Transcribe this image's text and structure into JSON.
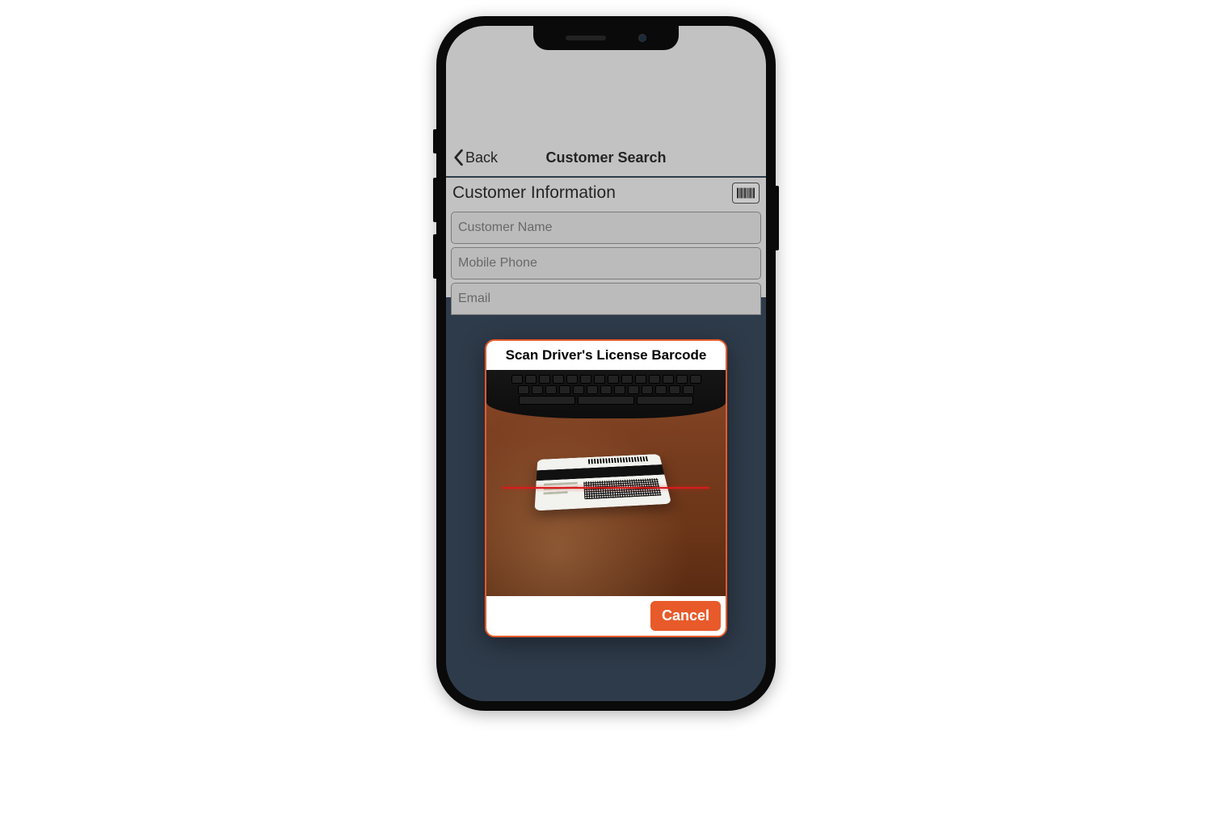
{
  "nav": {
    "back_label": "Back",
    "title": "Customer Search"
  },
  "section": {
    "title": "Customer Information"
  },
  "fields": {
    "name_placeholder": "Customer Name",
    "phone_placeholder": "Mobile Phone",
    "email_placeholder": "Email"
  },
  "modal": {
    "title": "Scan Driver's License Barcode",
    "cancel_label": "Cancel"
  },
  "colors": {
    "accent": "#e85a2a",
    "app_bg": "#12253d"
  }
}
